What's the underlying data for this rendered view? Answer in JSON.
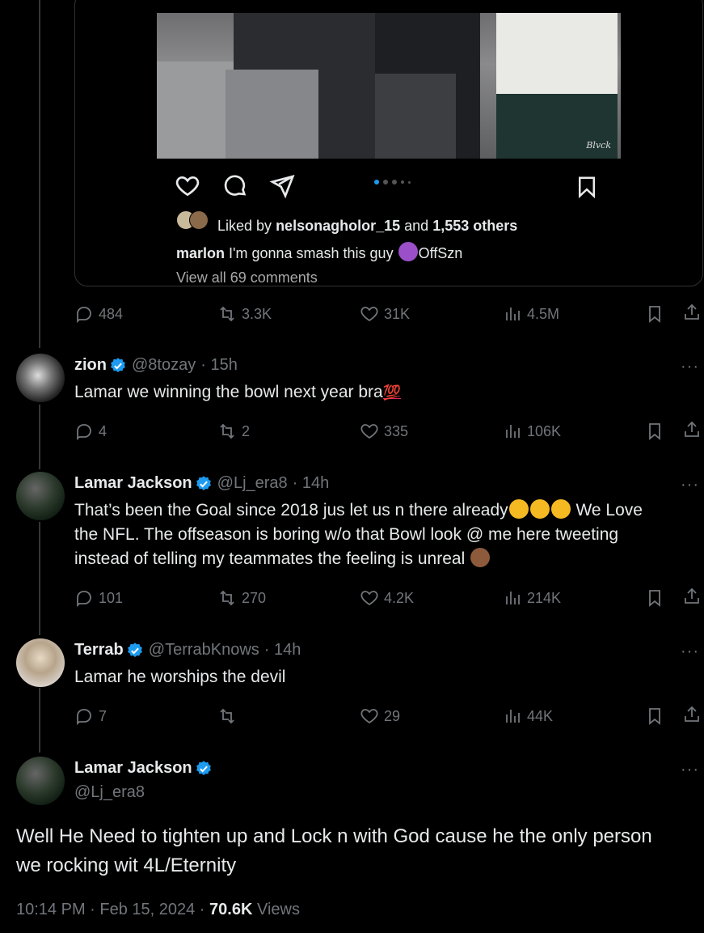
{
  "embed": {
    "signature": "Blvck",
    "liked_prefix": "Liked by",
    "liked_user": "nelsonagholor_15",
    "liked_and": "and",
    "liked_others": "1,553 others",
    "caption_user": "marlon",
    "caption_text": "I'm gonna smash this guy",
    "caption_tag": "OffSzn",
    "view_comments": "View all 69 comments"
  },
  "main_post_stats": {
    "replies": "484",
    "reposts": "3.3K",
    "likes": "31K",
    "views": "4.5M"
  },
  "replies": [
    {
      "name": "zion",
      "handle": "@8tozay",
      "time": "· 15h",
      "text": "Lamar we winning the bowl next year bra",
      "emoji_after": "💯",
      "stats": {
        "replies": "4",
        "reposts": "2",
        "likes": "335",
        "views": "106K"
      }
    },
    {
      "name": "Lamar Jackson",
      "handle": "@Lj_era8",
      "time": "· 14h",
      "text_line1": "That’s been the Goal since 2018 jus let us n there already",
      "text_line1_after": "We Love",
      "text_line2": "the NFL. The offseason is boring w/o that Bowl look @ me here tweeting",
      "text_line3": "instead of telling my teammates the feeling is unreal",
      "stats": {
        "replies": "101",
        "reposts": "270",
        "likes": "4.2K",
        "views": "214K"
      }
    },
    {
      "name": "Terrab",
      "handle": "@TerrabKnows",
      "time": "· 14h",
      "text": "Lamar he worships the devil",
      "stats": {
        "replies": "7",
        "reposts": "",
        "likes": "29",
        "views": "44K"
      }
    }
  ],
  "focused": {
    "name": "Lamar Jackson",
    "handle": "@Lj_era8",
    "text": "Well He Need to tighten up and Lock n with God cause he the only person we rocking wit 4L/Eternity",
    "time": "10:14 PM · Feb 15, 2024 ·",
    "views_count": "70.6K",
    "views_label": "Views"
  },
  "more_label": "···",
  "colors": {
    "accent": "#1d9bf0",
    "muted": "#71767b",
    "text": "#e7e9ea",
    "background": "#000000"
  }
}
